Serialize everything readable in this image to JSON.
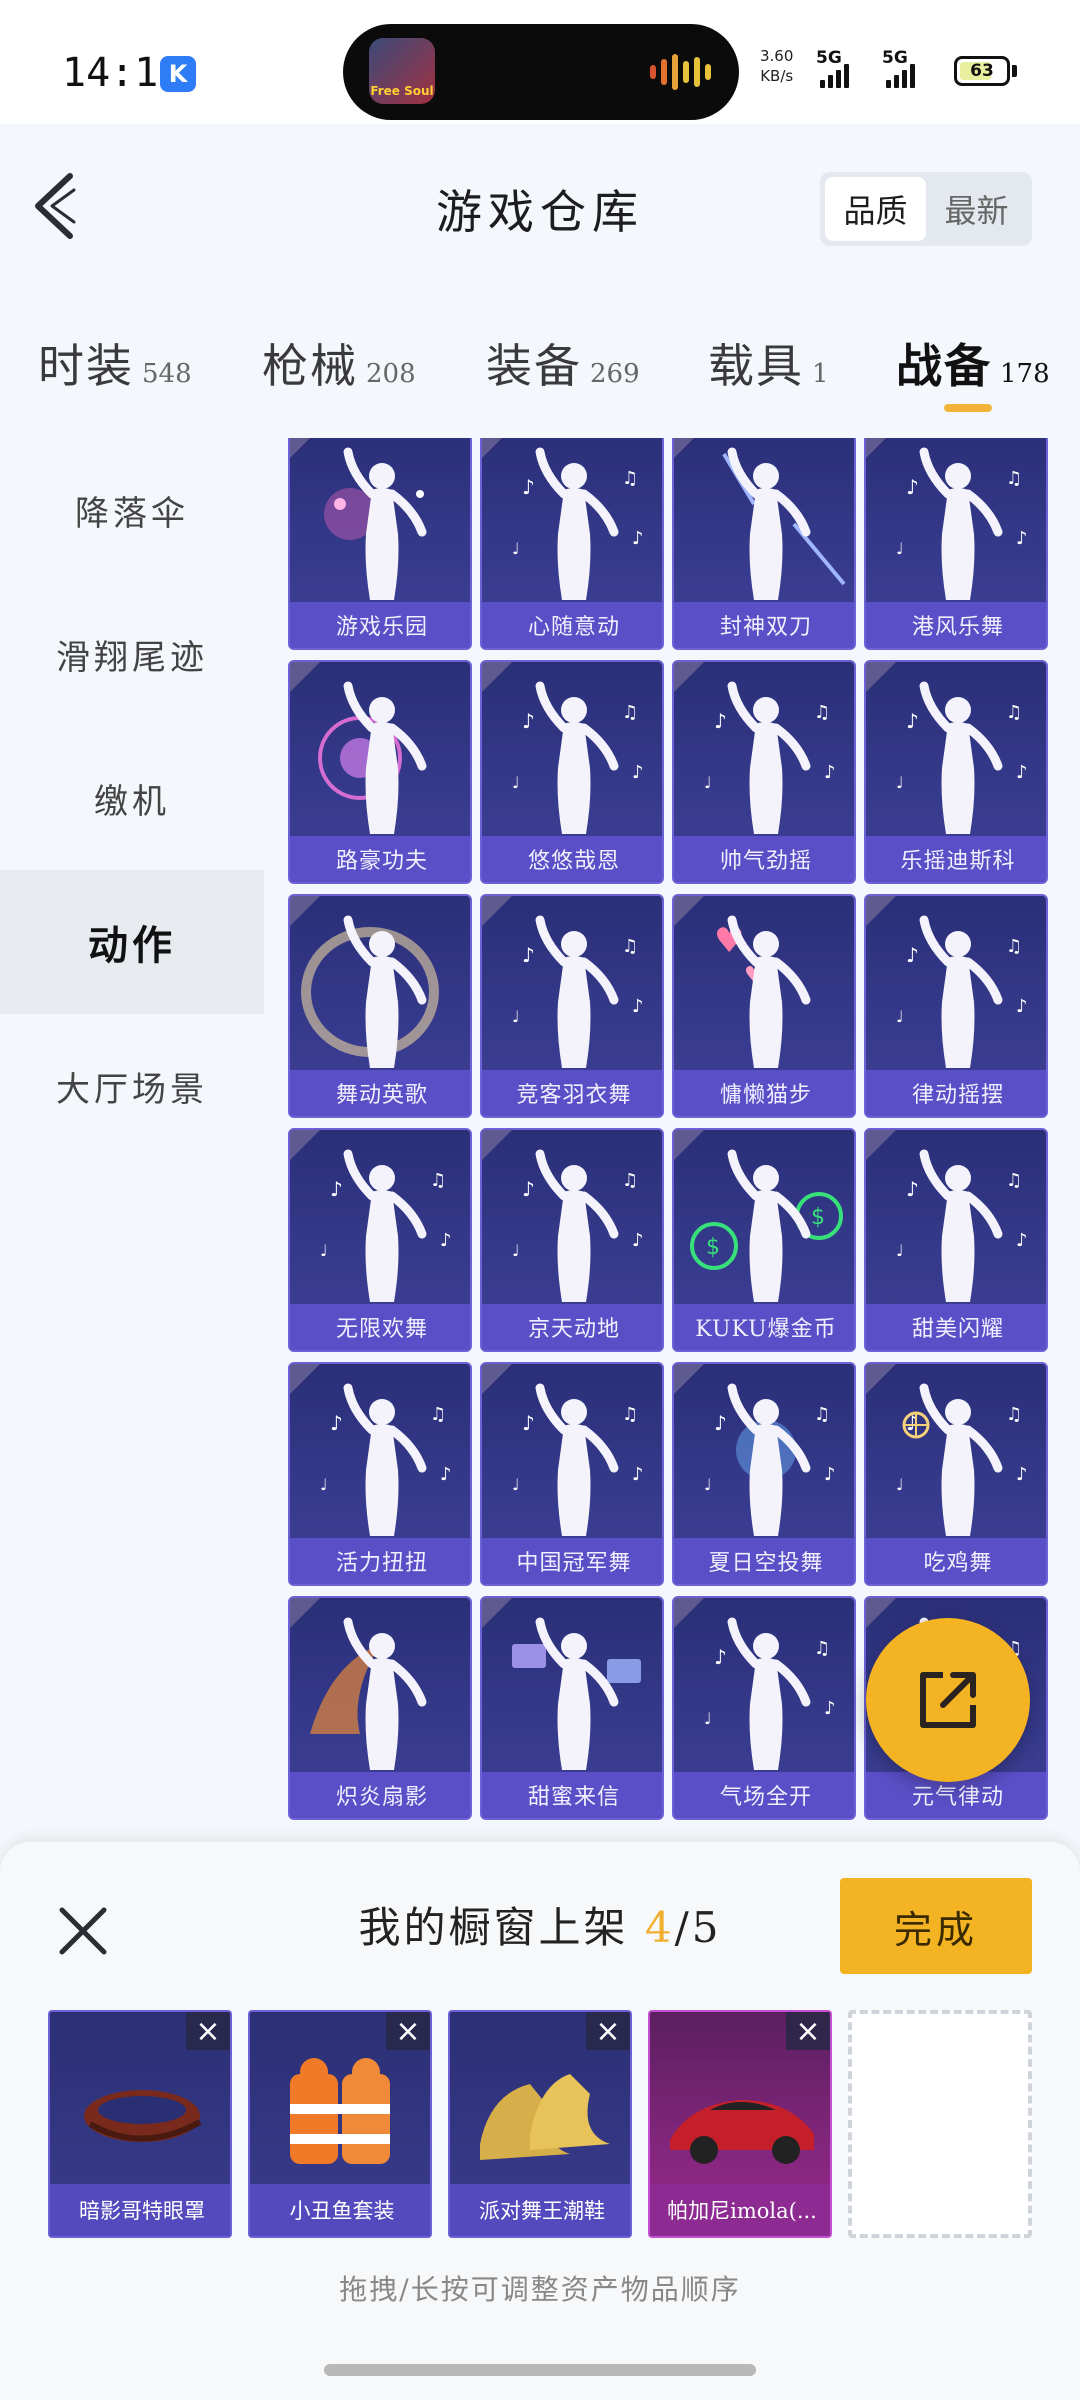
{
  "status_bar": {
    "time": "14:19",
    "app_badge": "K",
    "island_thumb_text": "Free Soul",
    "net_speed_value": "3.60",
    "net_speed_unit": "KB/s",
    "sim1": "5G",
    "sim2": "5G",
    "battery": "63"
  },
  "header": {
    "title": "游戏仓库",
    "sort_options": [
      "品质",
      "最新"
    ],
    "sort_selected": "品质"
  },
  "tabs": [
    {
      "label": "时装",
      "count": "548"
    },
    {
      "label": "枪械",
      "count": "208"
    },
    {
      "label": "装备",
      "count": "269"
    },
    {
      "label": "载具",
      "count": "1"
    },
    {
      "label": "战备",
      "count": "178",
      "active": true
    }
  ],
  "sidebar": {
    "items": [
      "降落伞",
      "滑翔尾迹",
      "缴机",
      "动作",
      "大厅场景"
    ],
    "active": "动作"
  },
  "grid": {
    "items": [
      {
        "name": "游戏乐园",
        "effect": "sparkle-pink"
      },
      {
        "name": "心随意动",
        "effect": "notes"
      },
      {
        "name": "封神双刀",
        "effect": "blades"
      },
      {
        "name": "港风乐舞",
        "effect": "notes"
      },
      {
        "name": "路豪功夫",
        "effect": "energy"
      },
      {
        "name": "悠悠哉恩",
        "effect": "notes"
      },
      {
        "name": "帅气劲摇",
        "effect": "notes"
      },
      {
        "name": "乐摇迪斯科",
        "effect": "notes"
      },
      {
        "name": "舞动英歌",
        "effect": "ring"
      },
      {
        "name": "竞客羽衣舞",
        "effect": "notes"
      },
      {
        "name": "慵懒猫步",
        "effect": "hearts"
      },
      {
        "name": "律动摇摆",
        "effect": "notes"
      },
      {
        "name": "无限欢舞",
        "effect": "notes"
      },
      {
        "name": "京天动地",
        "effect": "notes"
      },
      {
        "name": "KUKU爆金币",
        "effect": "money"
      },
      {
        "name": "甜美闪耀",
        "effect": "notes"
      },
      {
        "name": "活力扭扭",
        "effect": "notes"
      },
      {
        "name": "中国冠军舞",
        "effect": "notes"
      },
      {
        "name": "夏日空投舞",
        "effect": "glow-blue"
      },
      {
        "name": "吃鸡舞",
        "effect": "crosshair"
      },
      {
        "name": "炽炎扇影",
        "effect": "fire"
      },
      {
        "name": "甜蜜来信",
        "effect": "letters"
      },
      {
        "name": "气场全开",
        "effect": "notes"
      },
      {
        "name": "元气律动",
        "effect": "notes"
      }
    ]
  },
  "share_button": {
    "icon": "share-icon"
  },
  "showcase": {
    "title_prefix": "我的橱窗上架",
    "current": "4",
    "separator_total": "/5",
    "done_label": "完成",
    "items": [
      {
        "name": "暗影哥特眼罩",
        "kind": "mask"
      },
      {
        "name": "小丑鱼套装",
        "kind": "suit"
      },
      {
        "name": "派对舞王潮鞋",
        "kind": "shoes"
      },
      {
        "name": "帕加尼imola(...",
        "kind": "car"
      }
    ],
    "hint": "拖拽/长按可调整资产物品顺序"
  },
  "colors": {
    "accent": "#f4b323",
    "card_bg": "#2a2f78",
    "card_label": "#5a4fc6"
  }
}
